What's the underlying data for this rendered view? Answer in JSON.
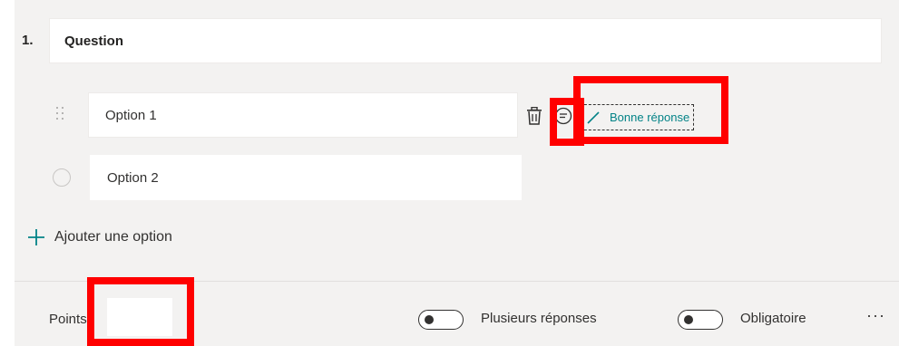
{
  "question": {
    "number": "1.",
    "title": "Question"
  },
  "options": [
    {
      "label": "Option 1"
    },
    {
      "label": "Option 2"
    }
  ],
  "option_actions": {
    "delete_icon": "trash-icon",
    "comment_icon": "comment-icon",
    "correct_answer_label": "Bonne réponse"
  },
  "add_option": {
    "label": "Ajouter une option"
  },
  "footer": {
    "points_label": "Points",
    "points_value": "",
    "multiple_answers_label": "Plusieurs réponses",
    "multiple_answers_on": false,
    "required_label": "Obligatoire",
    "required_on": false,
    "more_label": "···"
  },
  "colors": {
    "accent": "#038387",
    "highlight": "#ff0000",
    "panel": "#f3f2f1"
  }
}
